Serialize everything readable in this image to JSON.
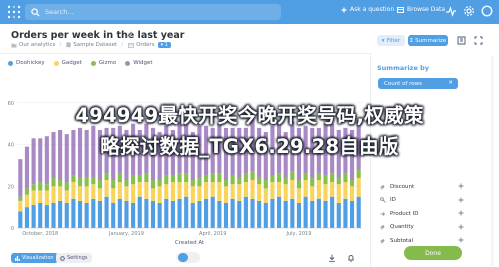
{
  "topbar": {
    "search_placeholder": "Search…",
    "ask_label": "Ask a question",
    "browse_label": "Browse Data"
  },
  "question": {
    "title": "Orders per week in the last year",
    "breadcrumbs": [
      {
        "label": "Our analytics",
        "icon": "collection-icon"
      },
      {
        "label": "Sample Dataset",
        "icon": "database-icon"
      },
      {
        "label": "Orders",
        "icon": "table-icon",
        "badge": "1"
      }
    ],
    "filter_label": "Filter",
    "summarize_label": "Summarize"
  },
  "colors": {
    "brand": "#509ee3",
    "doohickey": "#509ee3",
    "gadget": "#f9d45c",
    "gizmo": "#88bf4d",
    "widget": "#a989c5",
    "done": "#84bb4c"
  },
  "chart_data": {
    "type": "bar",
    "stacked": true,
    "xlabel": "Created At",
    "x_ticks": [
      "October, 2018",
      "January, 2019",
      "April, 2019",
      "July, 2019"
    ],
    "y_ticks": [
      "0",
      "20",
      "40",
      "60"
    ],
    "legend_position": "top-left",
    "series": [
      {
        "name": "Doohickey",
        "values": [
          8,
          10,
          11,
          12,
          11,
          12,
          13,
          12,
          14,
          13,
          12,
          14,
          13,
          15,
          12,
          14,
          13,
          12,
          15,
          14,
          13,
          12,
          14,
          13,
          14,
          15,
          12,
          13,
          14,
          15,
          13,
          12,
          14,
          13,
          15,
          14,
          13,
          12,
          14,
          15,
          13,
          14,
          12,
          15,
          13,
          14,
          13,
          15,
          12,
          14,
          13,
          15
        ]
      },
      {
        "name": "Gadget",
        "values": [
          5,
          6,
          7,
          6,
          7,
          8,
          7,
          6,
          8,
          7,
          8,
          7,
          6,
          8,
          7,
          8,
          7,
          9,
          7,
          8,
          6,
          8,
          7,
          9,
          8,
          7,
          8,
          7,
          8,
          7,
          9,
          8,
          7,
          8,
          7,
          9,
          8,
          7,
          8,
          7,
          8,
          9,
          7,
          8,
          7,
          9,
          8,
          7,
          9,
          8,
          7,
          9
        ]
      },
      {
        "name": "Gizmo",
        "values": [
          2,
          3,
          3,
          4,
          3,
          4,
          3,
          4,
          3,
          4,
          4,
          3,
          4,
          3,
          4,
          4,
          3,
          4,
          3,
          4,
          4,
          3,
          4,
          3,
          4,
          4,
          3,
          4,
          3,
          4,
          4,
          3,
          4,
          3,
          4,
          4,
          3,
          4,
          3,
          4,
          3,
          4,
          4,
          3,
          4,
          3,
          4,
          4,
          3,
          4,
          3,
          4
        ]
      },
      {
        "name": "Widget",
        "values": [
          18,
          20,
          22,
          21,
          23,
          22,
          24,
          23,
          22,
          24,
          23,
          25,
          24,
          22,
          25,
          23,
          24,
          25,
          22,
          24,
          25,
          23,
          24,
          22,
          25,
          24,
          23,
          25,
          24,
          22,
          24,
          25,
          23,
          24,
          22,
          25,
          24,
          23,
          24,
          25,
          22,
          24,
          25,
          23,
          24,
          22,
          25,
          24,
          23,
          22,
          24,
          23
        ]
      }
    ]
  },
  "footer": {
    "visualization_label": "Visualization",
    "settings_label": "Settings"
  },
  "sidebar": {
    "title": "Summarize by",
    "metric": "Count of rows",
    "fields": [
      "Discount",
      "ID",
      "Product ID",
      "Quantity",
      "Subtotal"
    ],
    "done_label": "Done"
  },
  "watermark": {
    "line1": "494949最快开奖今晚开奖号码,权威策",
    "line2": "略探讨数据_TGX6.29.28自由版"
  }
}
